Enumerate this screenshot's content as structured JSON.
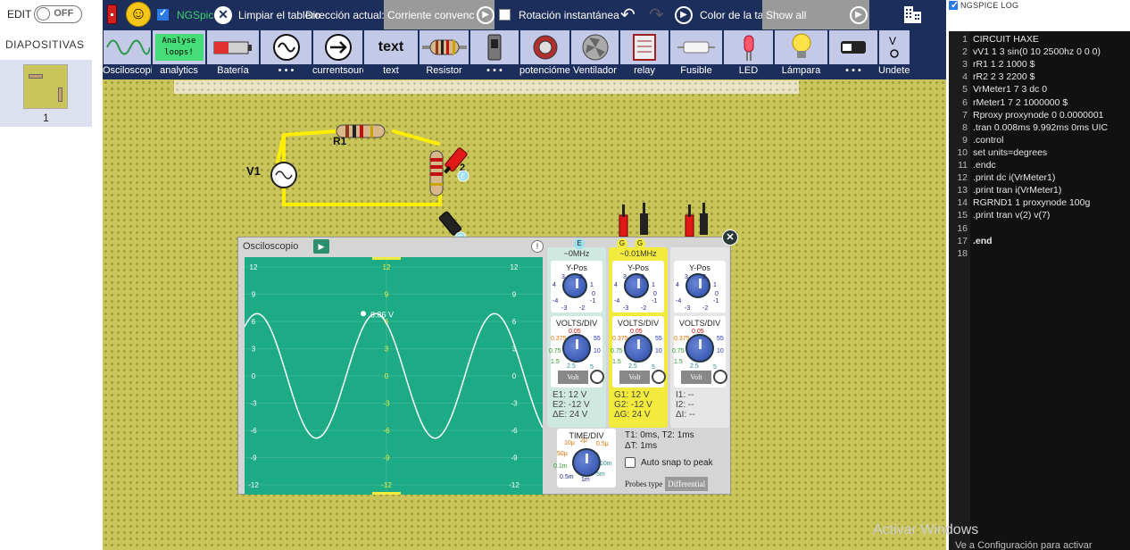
{
  "left": {
    "edit_label": "EDIT",
    "toggle_text": "OFF",
    "slides_title": "DIAPOSITIVAS",
    "slide_number": "1"
  },
  "topbar": {
    "ngspice_label": "NGSpice",
    "clear_label": "Limpiar el tablero",
    "direction_label": "Dirección actual:",
    "direction_value": "Corriente convencional",
    "rotation_label": "Rotación instantánea",
    "color_label": "Color de la tabla",
    "show_value": "Show all",
    "icons": [
      "power-icon",
      "smiley-icon",
      "undo-icon",
      "redo-icon",
      "play-icon",
      "building-icon"
    ]
  },
  "components": [
    {
      "label": "Osciloscopio",
      "pic": "sine"
    },
    {
      "label": "analytics",
      "pic": "analyse"
    },
    {
      "label": "Batería",
      "pic": "battery"
    },
    {
      "label": "• • •",
      "pic": "ac-source"
    },
    {
      "label": "currentsource",
      "pic": "arrow"
    },
    {
      "label": "text",
      "pic": "text"
    },
    {
      "label": "Resistor",
      "pic": "resistor"
    },
    {
      "label": "• • •",
      "pic": "switch"
    },
    {
      "label": "potenciómetro",
      "pic": "pot"
    },
    {
      "label": "Ventilador",
      "pic": "fan"
    },
    {
      "label": "relay",
      "pic": "relay"
    },
    {
      "label": "Fusible",
      "pic": "fuse"
    },
    {
      "label": "LED",
      "pic": "led"
    },
    {
      "label": "Lámpara",
      "pic": "lamp"
    },
    {
      "label": "• • •",
      "pic": "buzzer"
    },
    {
      "label": "Undetermined",
      "pic": "undetermined"
    }
  ],
  "analyse_text": [
    "Analyse",
    "loops!"
  ],
  "text_pic": "text",
  "circuit": {
    "v1_label": "V1",
    "r1_label": "R1",
    "r2_label": "2",
    "probe_e": "E"
  },
  "oscilloscope": {
    "title": "Osciloscopio",
    "peak_label": "6.86 V",
    "y_ticks": [
      "12",
      "9",
      "6",
      "3",
      "0",
      "-3",
      "-6",
      "-9",
      "-12"
    ],
    "channel_tags": {
      "e": "E",
      "g": "G"
    },
    "channels": [
      {
        "name": "E",
        "freq": "~0MHz",
        "ypos": "Y-Pos",
        "vdiv": "VOLTS/DIV",
        "mode": "Volt",
        "readout": [
          "E1: 12 V",
          "E2: -12 V",
          "ΔE: 24 V"
        ],
        "color": "#cfe8e0"
      },
      {
        "name": "G",
        "freq": "~0.01MHz",
        "ypos": "Y-Pos",
        "vdiv": "VOLTS/DIV",
        "mode": "Volt",
        "readout": [
          "G1: 12 V",
          "G2: -12 V",
          "ΔG: 24 V"
        ],
        "color": "#f2ea3c"
      },
      {
        "name": "I",
        "freq": "",
        "ypos": "Y-Pos",
        "vdiv": "VOLTS/DIV",
        "mode": "Volt",
        "readout": [
          "I1: --",
          "I2: --",
          "ΔI: --"
        ],
        "color": "#e6e6e6"
      }
    ],
    "ypos_scale": [
      "4",
      "3",
      "2",
      "1",
      "0",
      "-1",
      "-2",
      "-3",
      "-4"
    ],
    "vdiv_scale": [
      "0.375",
      "0.05",
      "0.75",
      "1.5",
      "2.5",
      "5",
      "10",
      "55"
    ],
    "time_title": "TIME/DIV",
    "time_scale": [
      "10μ",
      "2μ",
      "0.5μ",
      "50μ",
      "0.1m",
      "0.5m",
      "1m",
      "5m",
      "10m"
    ],
    "t_info": [
      "T1: 0ms, T2: 1ms",
      "ΔT: 1ms"
    ],
    "snap_label": "Auto snap to peak",
    "probes_label": "Probes type",
    "probes_value": "Differential"
  },
  "log": {
    "header": "NGSPICE LOG",
    "lines": [
      {
        "n": "1",
        "t": "CIRCUIT HAXE"
      },
      {
        "n": "2",
        "t": "vV1 1 3 sin(0 10 2500hz 0 0 0)"
      },
      {
        "n": "3",
        "t": "rR1 1 2 1000 $"
      },
      {
        "n": "4",
        "t": "rR2 2 3 2200 $"
      },
      {
        "n": "5",
        "t": "VrMeter1 7 3 dc 0"
      },
      {
        "n": "6",
        "t": "rMeter1 7 2 1000000 $"
      },
      {
        "n": "7",
        "t": "Rproxy proxynode 0 0.0000001"
      },
      {
        "n": "8",
        "t": ".tran 0.008ms 9.992ms 0ms UIC"
      },
      {
        "n": "9",
        "t": ".control"
      },
      {
        "n": "10",
        "t": "set units=degrees"
      },
      {
        "n": "11",
        "t": ".endc"
      },
      {
        "n": "12",
        "t": ".print dc i(VrMeter1)"
      },
      {
        "n": "13",
        "t": ".print tran i(VrMeter1)"
      },
      {
        "n": "14",
        "t": "RGRND1 1 proxynode 100g"
      },
      {
        "n": "15",
        "t": ".print tran v(2) v(7)"
      },
      {
        "n": "16",
        "t": ""
      },
      {
        "n": "17",
        "t": ".end"
      },
      {
        "n": "18",
        "t": ""
      }
    ]
  },
  "watermark": "Activar Windows",
  "watermark_sub": "Ve a Configuración para activar Windows.",
  "colors": {
    "topbar": "#1c2f5c",
    "board": "#c9c55a",
    "scope_screen": "#1cab84",
    "wave": "#ffffff",
    "wire": "#ffee00"
  }
}
